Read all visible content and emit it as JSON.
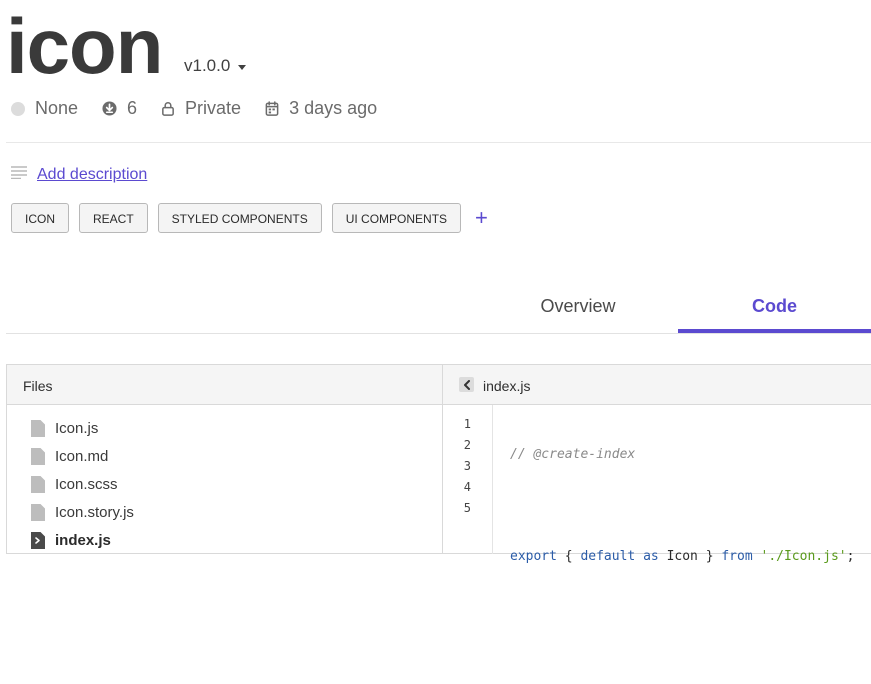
{
  "package": {
    "name": "icon",
    "version": "v1.0.0"
  },
  "meta": {
    "status": "None",
    "downloads": "6",
    "visibility": "Private",
    "updated": "3 days ago"
  },
  "description": {
    "link_label": "Add description"
  },
  "tags": [
    "ICON",
    "REACT",
    "STYLED COMPONENTS",
    "UI COMPONENTS"
  ],
  "tabs": {
    "overview": "Overview",
    "code": "Code",
    "active": "Code"
  },
  "files_panel": {
    "header": "Files",
    "files": [
      "Icon.js",
      "Icon.md",
      "Icon.scss",
      "Icon.story.js",
      "index.js"
    ],
    "active_file": "index.js"
  },
  "code_panel": {
    "filename": "index.js",
    "line_numbers": [
      "1",
      "2",
      "3",
      "4",
      "5"
    ],
    "lines": {
      "l1_comment": "// @create-index",
      "l3_export": "export",
      "l3_open": " { ",
      "l3_default": "default",
      "l3_as": " as ",
      "l3_ident": "Icon",
      "l3_close": " } ",
      "l3_from": "from",
      "l3_space": " ",
      "l3_string": "'./Icon.js'",
      "l3_semi": ";"
    }
  },
  "colors": {
    "accent": "#5b4ad0",
    "string": "#5a9a1c",
    "keyword": "#2b5ca8"
  }
}
